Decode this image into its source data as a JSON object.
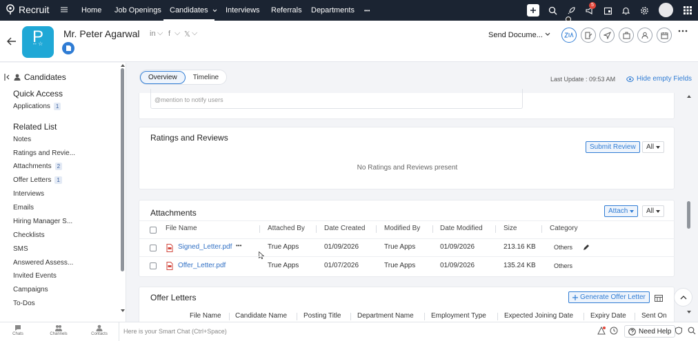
{
  "topbar": {
    "app_name": "Recruit",
    "tabs": [
      {
        "label": "Home"
      },
      {
        "label": "Job Openings"
      },
      {
        "label": "Candidates"
      },
      {
        "label": "Interviews"
      },
      {
        "label": "Referrals"
      },
      {
        "label": "Departments"
      }
    ],
    "more": "•••",
    "notification_count": "5"
  },
  "header": {
    "candidate_name": "Mr. Peter Agarwal",
    "avatar_letter": "P",
    "avatar_sub": "-- ☆",
    "social": {
      "linkedin": "in",
      "facebook": "f",
      "x": "𝕏"
    },
    "send_documents": "Send Docume..."
  },
  "sidebar": {
    "title": "Candidates",
    "quick_access_heading": "Quick Access",
    "quick_access": [
      {
        "label": "Applications",
        "count": "1"
      }
    ],
    "related_list_heading": "Related List",
    "related_list": [
      {
        "label": "Notes",
        "count": ""
      },
      {
        "label": "Ratings and Revie...",
        "count": ""
      },
      {
        "label": "Attachments",
        "count": "2"
      },
      {
        "label": "Offer Letters",
        "count": "1"
      },
      {
        "label": "Interviews",
        "count": ""
      },
      {
        "label": "Emails",
        "count": ""
      },
      {
        "label": "Hiring Manager S...",
        "count": ""
      },
      {
        "label": "Checklists",
        "count": ""
      },
      {
        "label": "SMS",
        "count": ""
      },
      {
        "label": "Answered Assess...",
        "count": ""
      },
      {
        "label": "Invited Events",
        "count": ""
      },
      {
        "label": "Campaigns",
        "count": ""
      },
      {
        "label": "To-Dos",
        "count": ""
      }
    ]
  },
  "view_tabs": {
    "overview": "Overview",
    "timeline": "Timeline"
  },
  "last_update": "Last Update : 09:53 AM",
  "hide_empty": "Hide empty Fields",
  "notes": {
    "mention_placeholder": "@mention to notify users"
  },
  "ratings": {
    "title": "Ratings and Reviews",
    "submit": "Submit Review",
    "filter": "All",
    "empty": "No Ratings and Reviews present"
  },
  "attachments": {
    "title": "Attachments",
    "attach": "Attach",
    "filter": "All",
    "columns": [
      "File Name",
      "Attached By",
      "Date Created",
      "Modified By",
      "Date Modified",
      "Size",
      "Category"
    ],
    "rows": [
      {
        "file": "Signed_Letter.pdf",
        "attached_by": "True Apps",
        "created": "01/09/2026",
        "modified_by": "True Apps",
        "modified": "01/09/2026",
        "size": "213.16 KB",
        "category": "Others",
        "more": "•••"
      },
      {
        "file": "Offer_Letter.pdf",
        "attached_by": "True Apps",
        "created": "01/07/2026",
        "modified_by": "True Apps",
        "modified": "01/09/2026",
        "size": "135.24 KB",
        "category": "Others"
      }
    ]
  },
  "offer_letters": {
    "title": "Offer Letters",
    "generate": "Generate Offer Letter",
    "columns": [
      "File Name",
      "Candidate Name",
      "Posting Title",
      "Department Name",
      "Employment Type",
      "Expected Joining Date",
      "Expiry Date",
      "Sent On"
    ]
  },
  "bottombar": {
    "items": [
      {
        "label": "Chats"
      },
      {
        "label": "Channels"
      },
      {
        "label": "Contacts"
      }
    ],
    "smart_chat_placeholder": "Here is your Smart Chat (Ctrl+Space)",
    "need_help": "Need Help"
  }
}
